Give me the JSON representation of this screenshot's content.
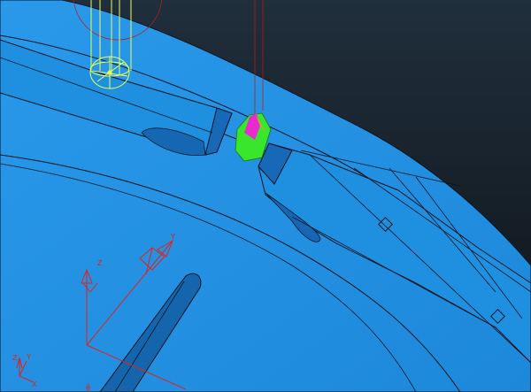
{
  "viewport": {
    "background_top": "#202f3c",
    "background_bottom": "#0d1217",
    "part_color": "#1f8fe0",
    "part_shadow": "#0f5fa8",
    "edge_color": "#0a1420",
    "tool_color": "#e8ff5a",
    "tool_path_color": "#c01818",
    "stock_green": "#39e62b",
    "stock_magenta": "#e62ccf",
    "axis_color": "#e0231e"
  },
  "triads": [
    {
      "x_label": "",
      "y_label": "Y",
      "z_label": "Z"
    },
    {
      "x_label": "X",
      "y_label": "Y",
      "z_label": "Z"
    }
  ],
  "small_markers": [
    "marker-left",
    "marker-right"
  ]
}
